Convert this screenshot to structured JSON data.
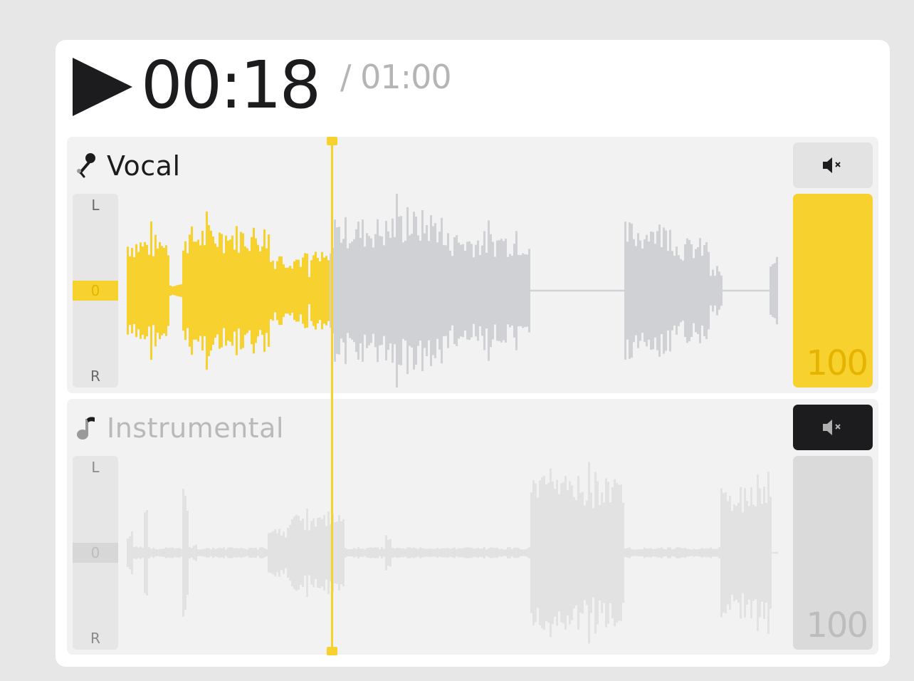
{
  "player": {
    "current_time": "00:18",
    "total_time": "/ 01:00",
    "progress": 0.3
  },
  "colors": {
    "accent": "#f7d22f",
    "accent_text": "#e6b300",
    "dark": "#1c1b1e",
    "inactive_wave": "#d0d1d4",
    "muted_wave": "#e2e2e2"
  },
  "tracks": [
    {
      "name": "Vocal",
      "icon": "microphone-icon",
      "muted": false,
      "pan": {
        "left_label": "L",
        "right_label": "R",
        "value": "0"
      },
      "volume": "100",
      "mute_icon": "speaker-mute-icon"
    },
    {
      "name": "Instrumental",
      "icon": "music-note-icon",
      "muted": true,
      "pan": {
        "left_label": "L",
        "right_label": "R",
        "value": "0"
      },
      "volume": "100",
      "mute_icon": "speaker-mute-icon"
    }
  ]
}
